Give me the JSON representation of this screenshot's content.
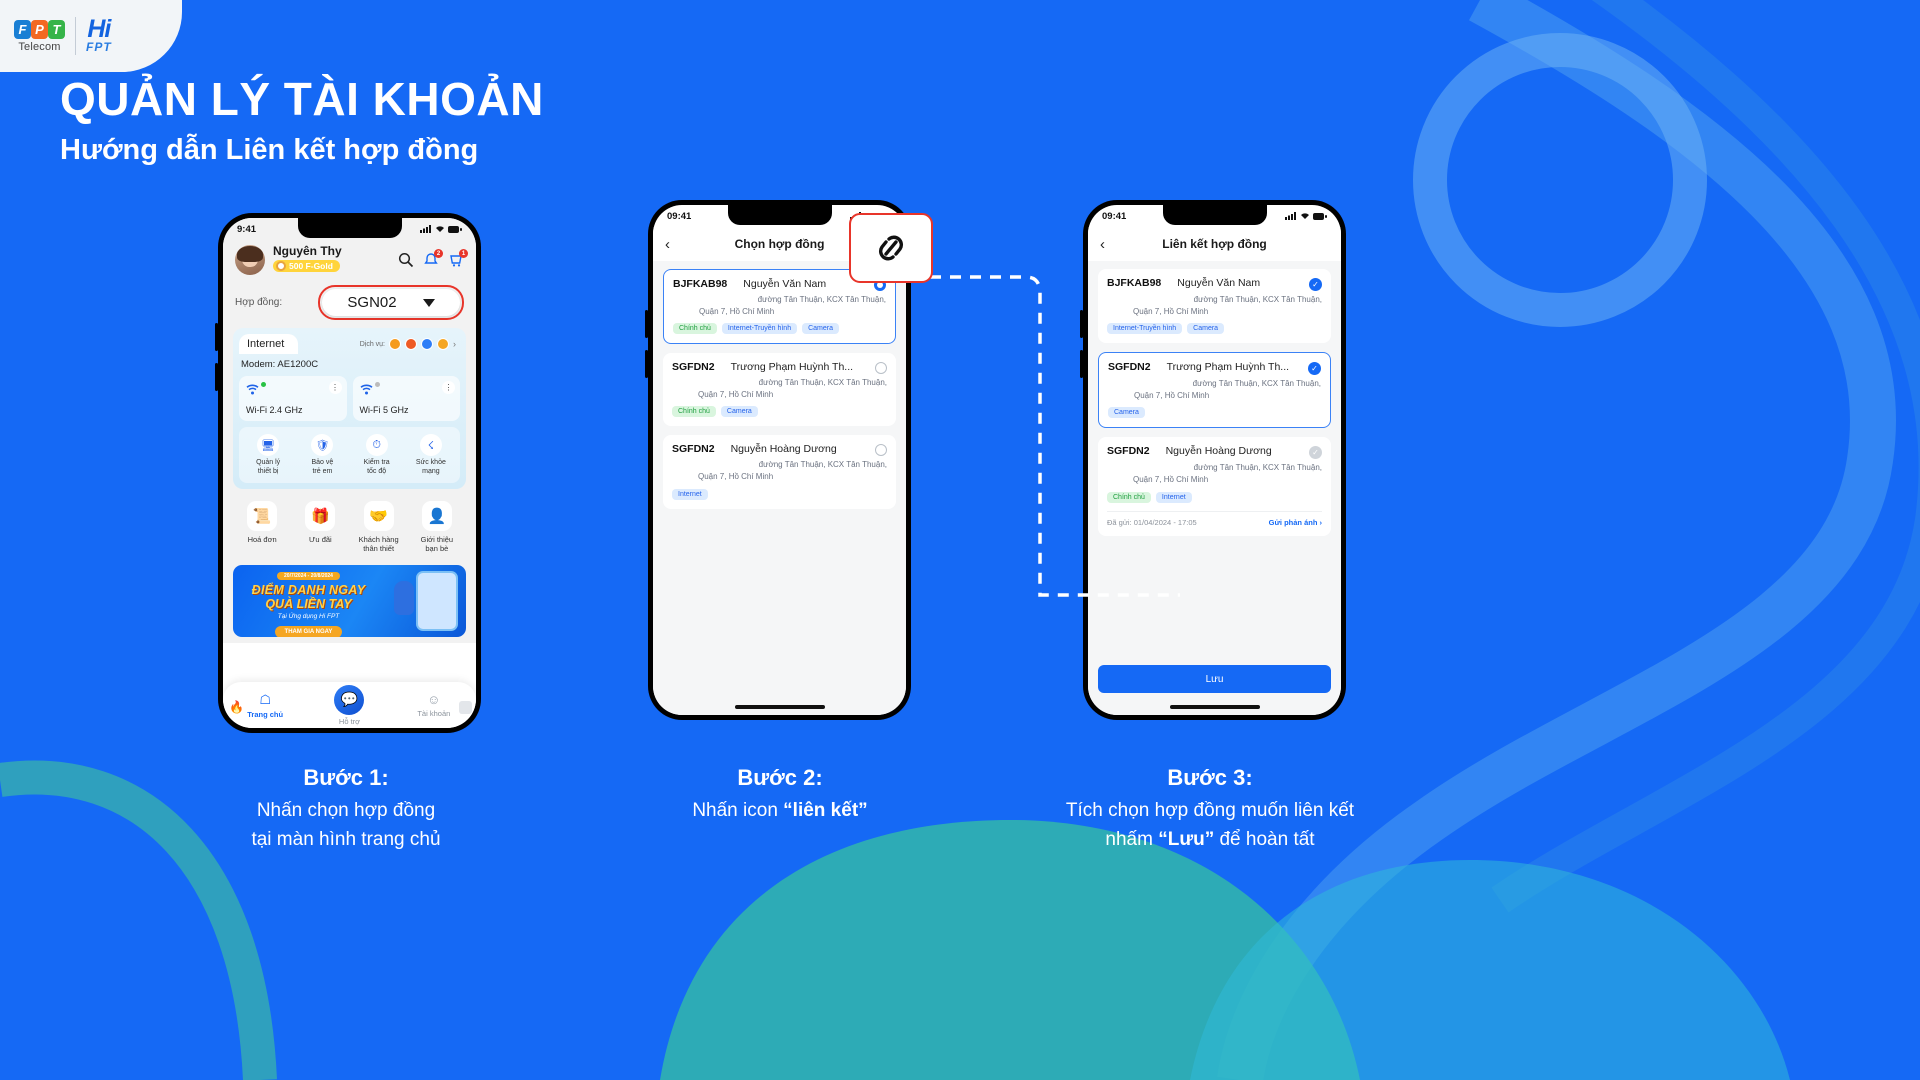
{
  "brand": {
    "fpt_letters": [
      "F",
      "P",
      "T"
    ],
    "fpt_sub": "Telecom",
    "hi_word": "Hi",
    "hi_sub": "FPT"
  },
  "header": {
    "title": "QUẢN LÝ TÀI KHOẢN",
    "subtitle": "Hướng dẫn Liên kết hợp đồng"
  },
  "phone1": {
    "time": "9:41",
    "user_name": "Nguyên Thy",
    "gold": "500 F-Gold",
    "search_icon": "search-icon",
    "bell_badge": "2",
    "cart_badge": "1",
    "contract_label": "Hợp đồng:",
    "contract_value": "SGN02",
    "tab_internet": "Internet",
    "service_label": "Dịch vụ:",
    "modem": "Modem: AE1200C",
    "wifi": [
      {
        "label": "Wi-Fi 2.4 GHz",
        "status": "on"
      },
      {
        "label": "Wi-Fi 5 GHz",
        "status": "off"
      }
    ],
    "tools": [
      {
        "label": "Quản lý\nthiết bị",
        "icon": "devices-icon"
      },
      {
        "label": "Bảo vệ\ntrẻ em",
        "icon": "shield-icon"
      },
      {
        "label": "Kiểm tra\ntốc độ",
        "icon": "speed-icon"
      },
      {
        "label": "Sức khỏe\nmạng",
        "icon": "network-health-icon"
      }
    ],
    "services": [
      {
        "label": "Hoá đơn",
        "icon": "invoice-icon"
      },
      {
        "label": "Ưu đãi",
        "icon": "gift-icon"
      },
      {
        "label": "Khách hàng\nthân thiết",
        "icon": "loyalty-icon"
      },
      {
        "label": "Giới thiệu\nbạn bè",
        "icon": "referral-icon"
      }
    ],
    "banner": {
      "date": "20/7/2024 - 20/8/2024",
      "line1": "ĐIỂM DANH NGAY",
      "line2": "QUÀ LIỀN TAY",
      "line3": "Tại Ứng dụng Hi FPT",
      "cta": "THAM GIA NGAY"
    },
    "nav": [
      {
        "label": "Trang chủ",
        "icon": "home-icon",
        "active": true
      },
      {
        "label": "Hỗ trợ",
        "icon": "support-icon",
        "active": false
      },
      {
        "label": "Tài khoản",
        "icon": "account-icon",
        "active": false
      }
    ]
  },
  "phone2": {
    "time": "09:41",
    "back_icon": "back-chevron-icon",
    "title": "Chọn hợp đồng",
    "cards": [
      {
        "code": "BJFKAB98",
        "name": "Nguyễn Văn Nam",
        "addr1": "đường Tân Thuận, KCX Tân Thuận,",
        "addr2": "Quận 7, Hồ Chí Minh",
        "tags": [
          {
            "text": "Chính chủ",
            "type": "green"
          },
          {
            "text": "Internet-Truyền hình",
            "type": "blue"
          },
          {
            "text": "Camera",
            "type": "blue"
          }
        ],
        "selected": true
      },
      {
        "code": "SGFDN2",
        "name": "Trương Phạm Huỳnh Th...",
        "addr1": "đường Tân Thuận, KCX Tân Thuận,",
        "addr2": "Quận 7, Hồ Chí Minh",
        "tags": [
          {
            "text": "Chính chủ",
            "type": "green"
          },
          {
            "text": "Camera",
            "type": "blue"
          }
        ],
        "selected": false
      },
      {
        "code": "SGFDN2",
        "name": "Nguyễn Hoàng Dương",
        "addr1": "đường Tân Thuận, KCX Tân Thuận,",
        "addr2": "Quận 7, Hồ Chí Minh",
        "tags": [
          {
            "text": "Internet",
            "type": "blue"
          }
        ],
        "selected": false
      }
    ]
  },
  "callout": {
    "icon": "link-icon"
  },
  "phone3": {
    "time": "09:41",
    "back_icon": "back-chevron-icon",
    "title": "Liên kết hợp đồng",
    "cards": [
      {
        "code": "BJFKAB98",
        "name": "Nguyễn Văn Nam",
        "addr1": "đường Tân Thuận, KCX Tân Thuận,",
        "addr2": "Quận 7, Hồ Chí Minh",
        "tags": [
          {
            "text": "Internet-Truyền hình",
            "type": "blue"
          },
          {
            "text": "Camera",
            "type": "blue"
          }
        ],
        "checked": true,
        "disabled": false
      },
      {
        "code": "SGFDN2",
        "name": "Trương Phạm Huỳnh Th...",
        "addr1": "đường Tân Thuận, KCX Tân Thuận,",
        "addr2": "Quận 7, Hồ Chí Minh",
        "tags": [
          {
            "text": "Camera",
            "type": "blue"
          }
        ],
        "checked": true,
        "disabled": false
      },
      {
        "code": "SGFDN2",
        "name": "Nguyễn Hoàng Dương",
        "addr1": "đường Tân Thuận, KCX Tân Thuận,",
        "addr2": "Quận 7, Hồ Chí Minh",
        "tags": [
          {
            "text": "Chính chủ",
            "type": "green"
          },
          {
            "text": "Internet",
            "type": "blue"
          }
        ],
        "checked": false,
        "disabled": true,
        "sent": "Đã gửi: 01/04/2024 - 17:05",
        "link": "Gửi phản ánh"
      }
    ],
    "save_label": "Lưu"
  },
  "steps": [
    {
      "title": "Bước 1:",
      "line1": "Nhấn chọn hợp đồng",
      "line2": "tại màn hình trang chủ"
    },
    {
      "title": "Bước 2:",
      "line1_pre": "Nhấn icon ",
      "line1_b": "“liên kết”",
      "line2": ""
    },
    {
      "title": "Bước 3:",
      "line1": "Tích chọn hợp đồng muốn liên kết",
      "line2_pre": "nhấm ",
      "line2_b": "“Lưu”",
      "line2_post": " để hoàn tất"
    }
  ],
  "colors": {
    "brand_blue": "#1569f5",
    "accent_red": "#e8352a",
    "green": "#1e9e3e"
  }
}
